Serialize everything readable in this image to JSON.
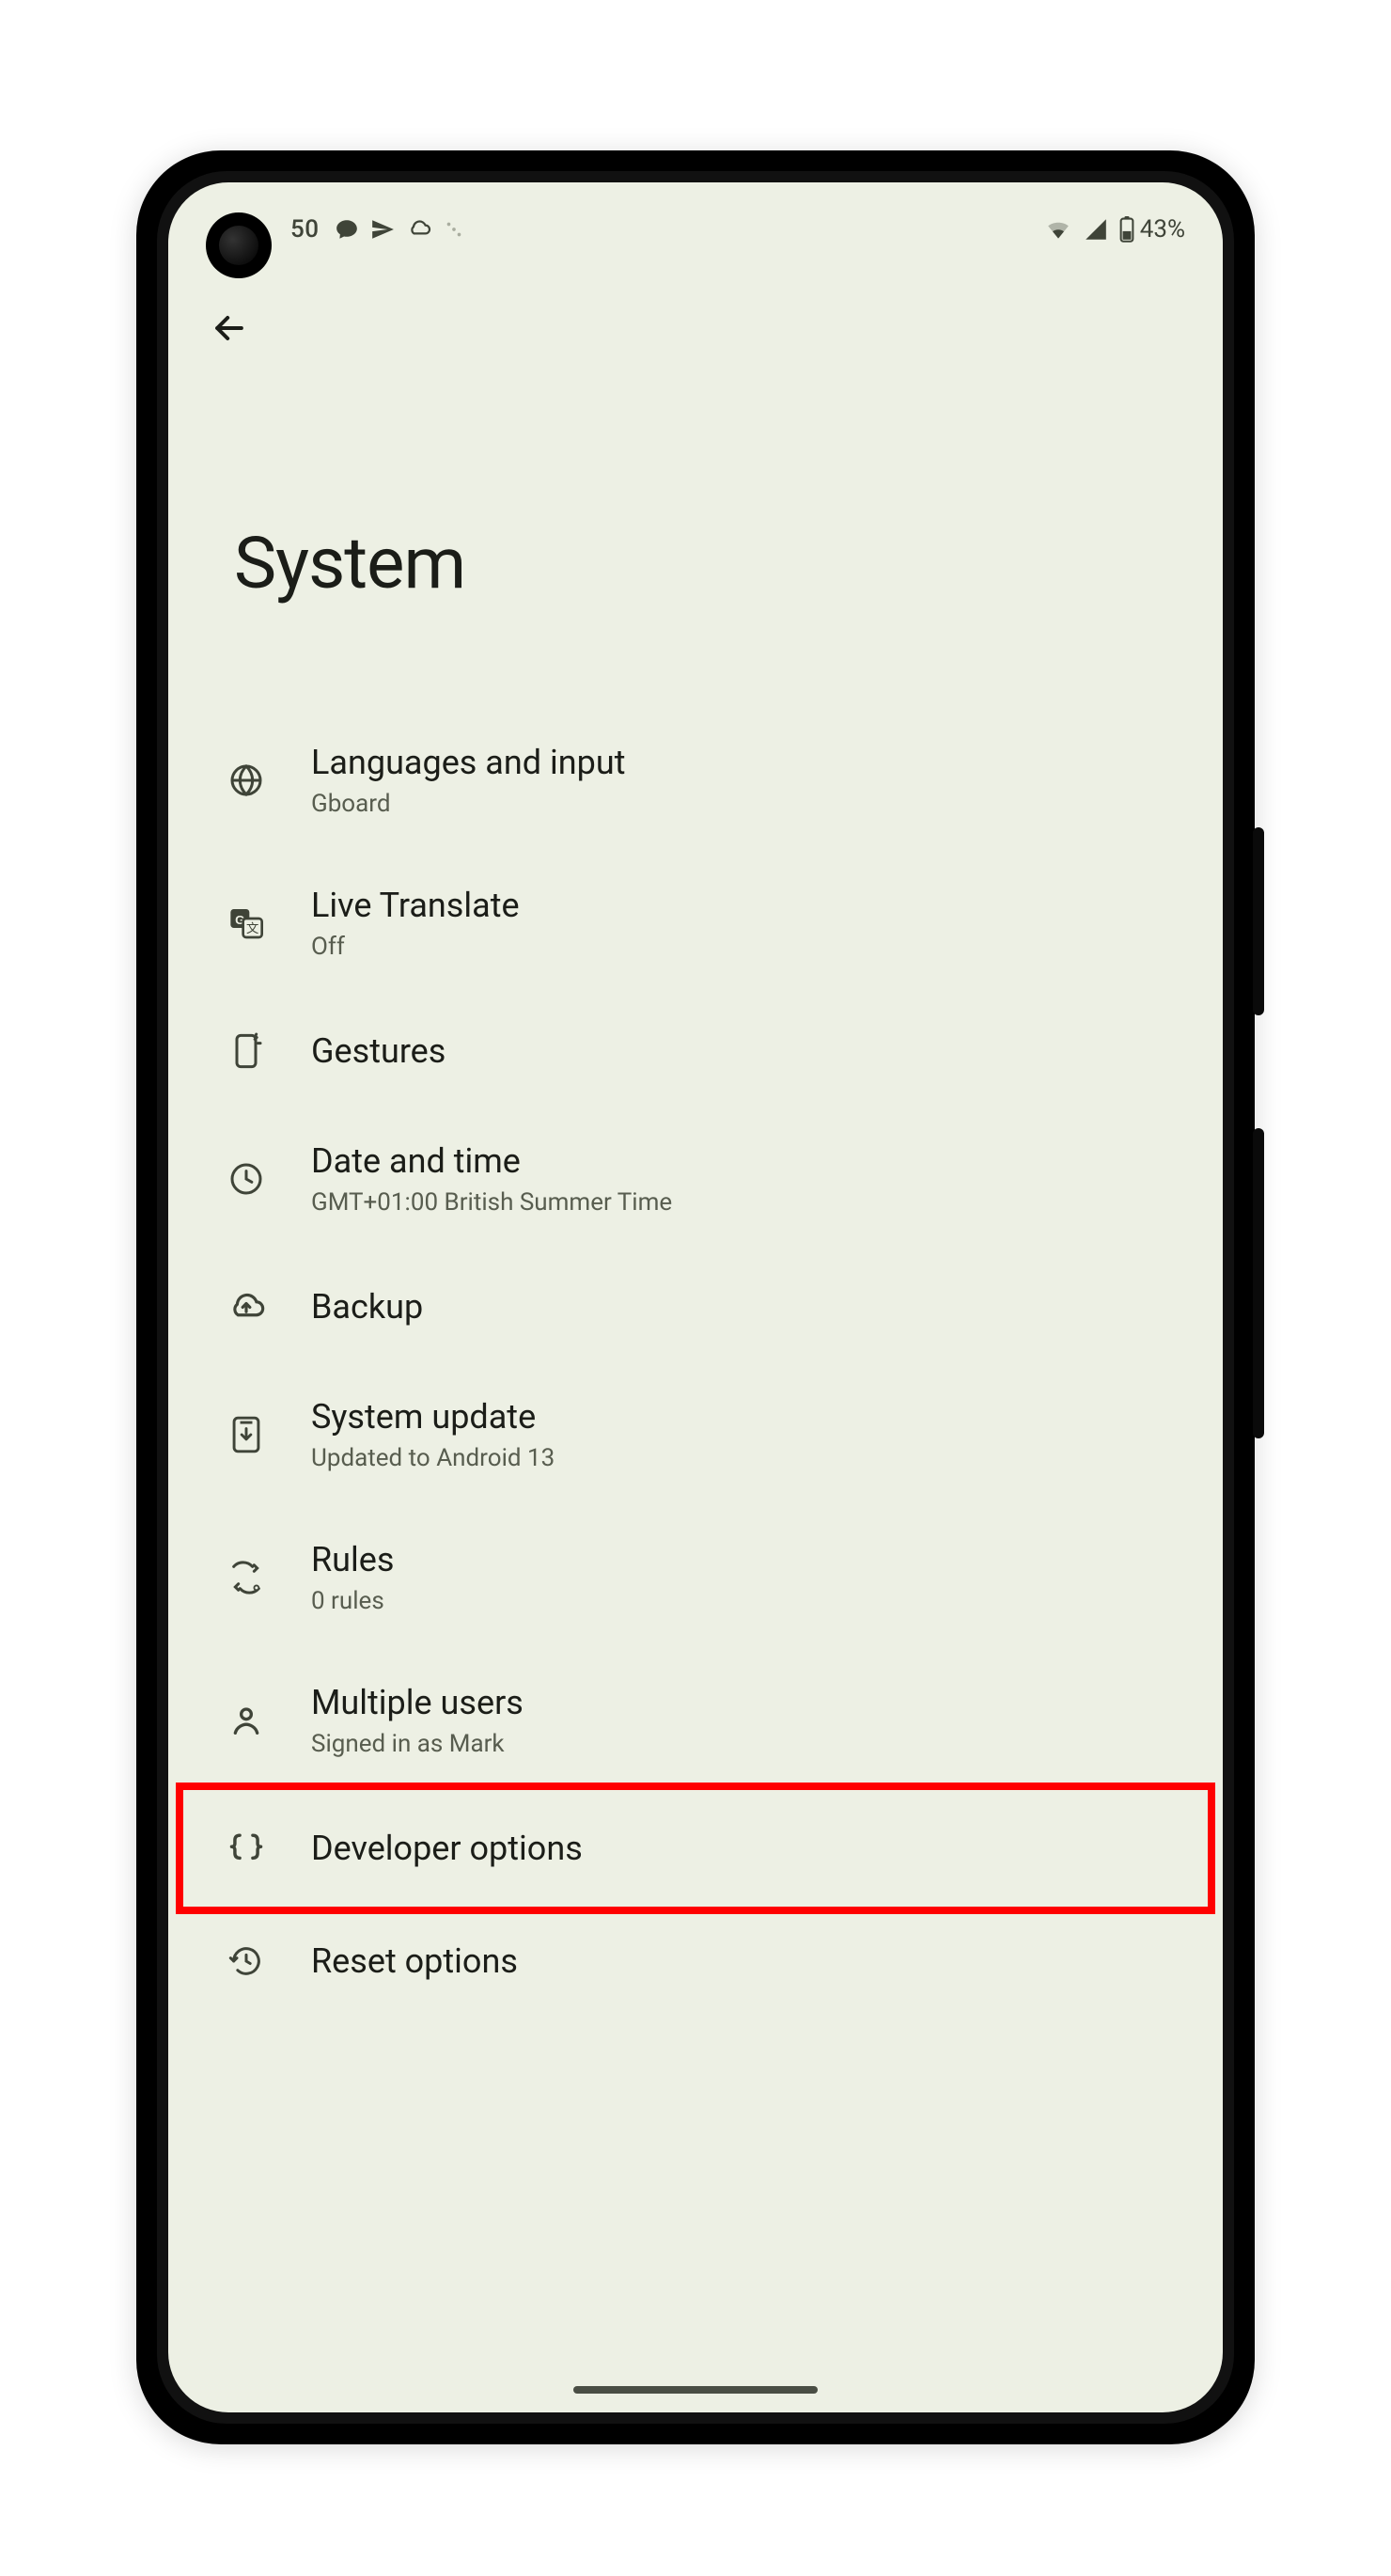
{
  "status": {
    "time": "50",
    "battery_pct": "43%"
  },
  "page": {
    "title": "System"
  },
  "items": [
    {
      "icon": "globe",
      "title": "Languages and input",
      "subtitle": "Gboard"
    },
    {
      "icon": "translate",
      "title": "Live Translate",
      "subtitle": "Off"
    },
    {
      "icon": "gesture-phone",
      "title": "Gestures",
      "subtitle": ""
    },
    {
      "icon": "clock",
      "title": "Date and time",
      "subtitle": "GMT+01:00 British Summer Time"
    },
    {
      "icon": "cloud-up",
      "title": "Backup",
      "subtitle": ""
    },
    {
      "icon": "phone-download",
      "title": "System update",
      "subtitle": "Updated to Android 13"
    },
    {
      "icon": "rules",
      "title": "Rules",
      "subtitle": "0 rules"
    },
    {
      "icon": "person",
      "title": "Multiple users",
      "subtitle": "Signed in as Mark"
    },
    {
      "icon": "braces",
      "title": "Developer options",
      "subtitle": ""
    },
    {
      "icon": "history",
      "title": "Reset options",
      "subtitle": ""
    }
  ],
  "highlight_index": 8
}
